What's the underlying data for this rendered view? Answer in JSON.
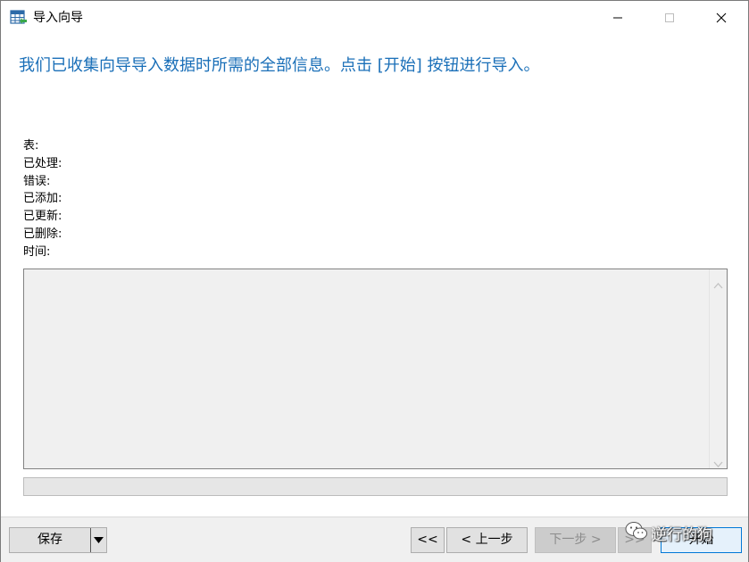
{
  "window": {
    "title": "导入向导",
    "controls": [
      "minimize-icon",
      "maximize-icon",
      "close-icon"
    ]
  },
  "header": {
    "message": "我们已收集向导导入数据时所需的全部信息。点击 [开始] 按钮进行导入。",
    "accent_color": "#1a6fb8"
  },
  "stats": {
    "labels": [
      "表:",
      "已处理:",
      "错误:",
      "已添加:",
      "已更新:",
      "已删除:",
      "时间:"
    ]
  },
  "log": {
    "text": ""
  },
  "progress": {
    "percent": 0
  },
  "footer": {
    "save_label": "保存",
    "first_label": "<<",
    "prev_label": "< 上一步",
    "next_label": "下一步 >",
    "last_label": ">>",
    "start_label": "开始"
  },
  "watermark": {
    "text": "逆行的狗",
    "icon": "wechat-icon"
  }
}
